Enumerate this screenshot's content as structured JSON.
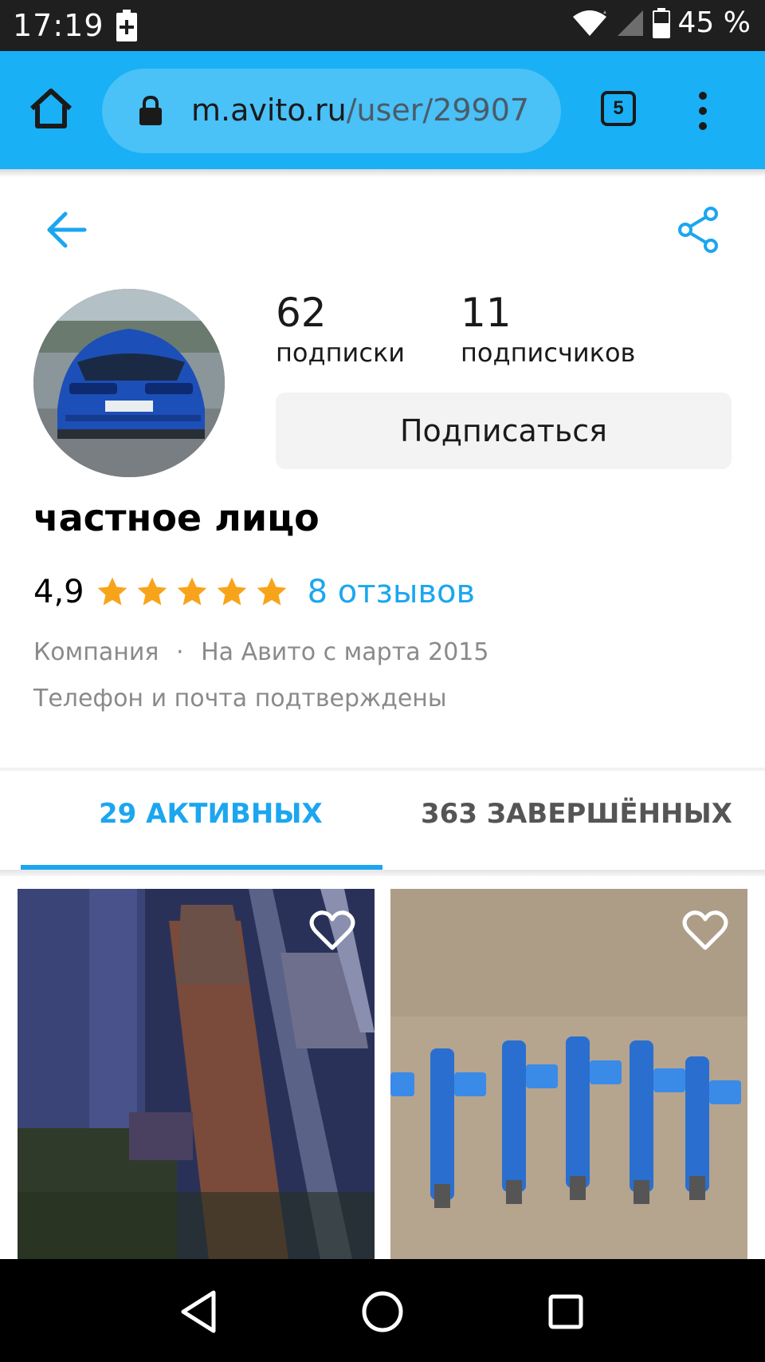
{
  "status_bar": {
    "time": "17:19",
    "battery_percent": "45 %"
  },
  "browser": {
    "url_domain": "m.avito.ru",
    "url_path": "/user/29907",
    "tabs_count": "5",
    "icons": [
      "home-icon",
      "lock-icon",
      "tabs-icon",
      "more-vert-icon"
    ],
    "accent_color": "#19b0f5"
  },
  "header": {
    "icons": [
      "arrow-back-icon",
      "share-icon"
    ]
  },
  "profile": {
    "subscriptions_count": "62",
    "subscriptions_label": "подписки",
    "followers_count": "11",
    "followers_label": "подписчиков",
    "subscribe_label": "Подписаться",
    "name": "частное лицо",
    "rating": "4,9",
    "stars": 5,
    "reviews_link": "8 отзывов",
    "meta_type": "Компания",
    "meta_separator": "·",
    "meta_since": "На Авито с марта 2015",
    "verified": "Телефон и почта подтверждены",
    "star_color": "#f8a41b",
    "link_color": "#1ca6ef"
  },
  "tabs": [
    {
      "label": "29 АКТИВНЫХ",
      "active": true
    },
    {
      "label": "363 ЗАВЕРШЁННЫХ",
      "active": false
    }
  ],
  "listings": [
    {
      "image": "rusty driveshaft photo",
      "favorite_icon": "heart-outline-icon"
    },
    {
      "image": "blue fuel injectors photo",
      "favorite_icon": "heart-outline-icon"
    }
  ],
  "nav_bar": {
    "icons": [
      "nav-back-icon",
      "nav-home-icon",
      "nav-recents-icon"
    ]
  }
}
